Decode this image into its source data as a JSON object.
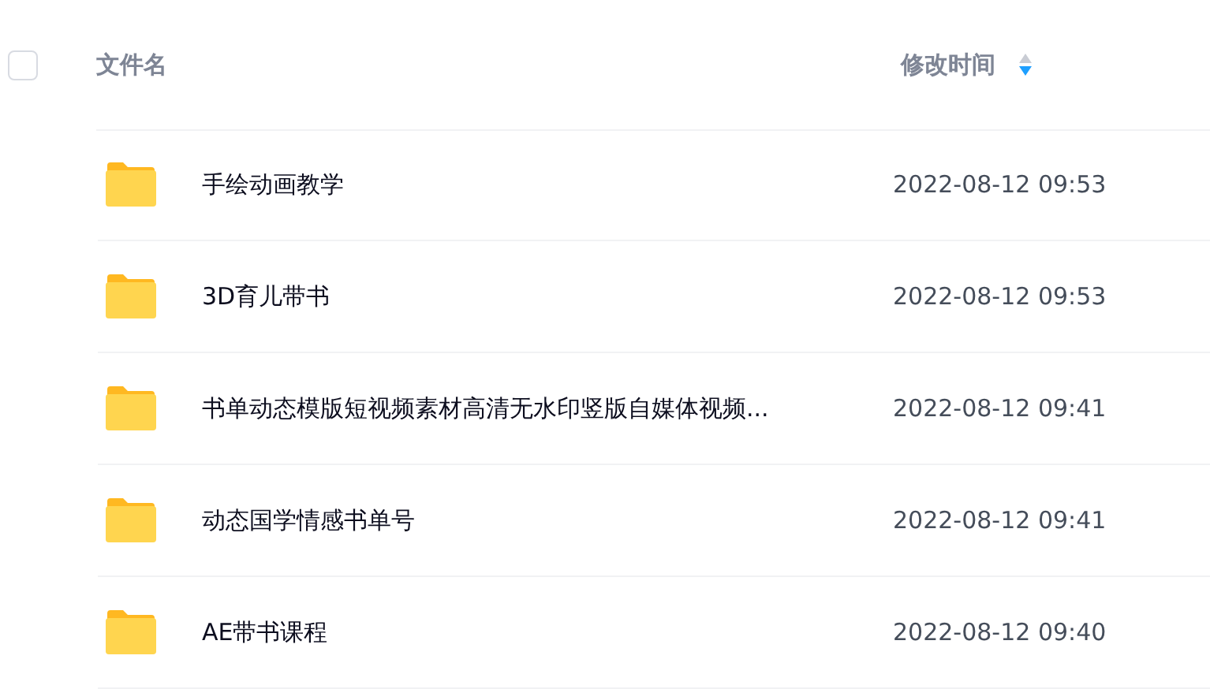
{
  "header": {
    "select_all": {
      "checked": false
    },
    "columns": [
      {
        "label": "文件名"
      },
      {
        "label": "修改时间",
        "sorted": true,
        "sort_ascending": false
      }
    ]
  },
  "rows": [
    {
      "name": "手绘动画教学",
      "modified": "2022-08-12 09:53"
    },
    {
      "name": "3D育儿带书",
      "modified": "2022-08-12 09:53"
    },
    {
      "name": "书单动态模版短视频素材高清无水印竖版自媒体视频...",
      "modified": "2022-08-12 09:41"
    },
    {
      "name": "动态国学情感书单号",
      "modified": "2022-08-12 09:41"
    },
    {
      "name": "AE带书课程",
      "modified": "2022-08-12 09:40"
    }
  ]
}
